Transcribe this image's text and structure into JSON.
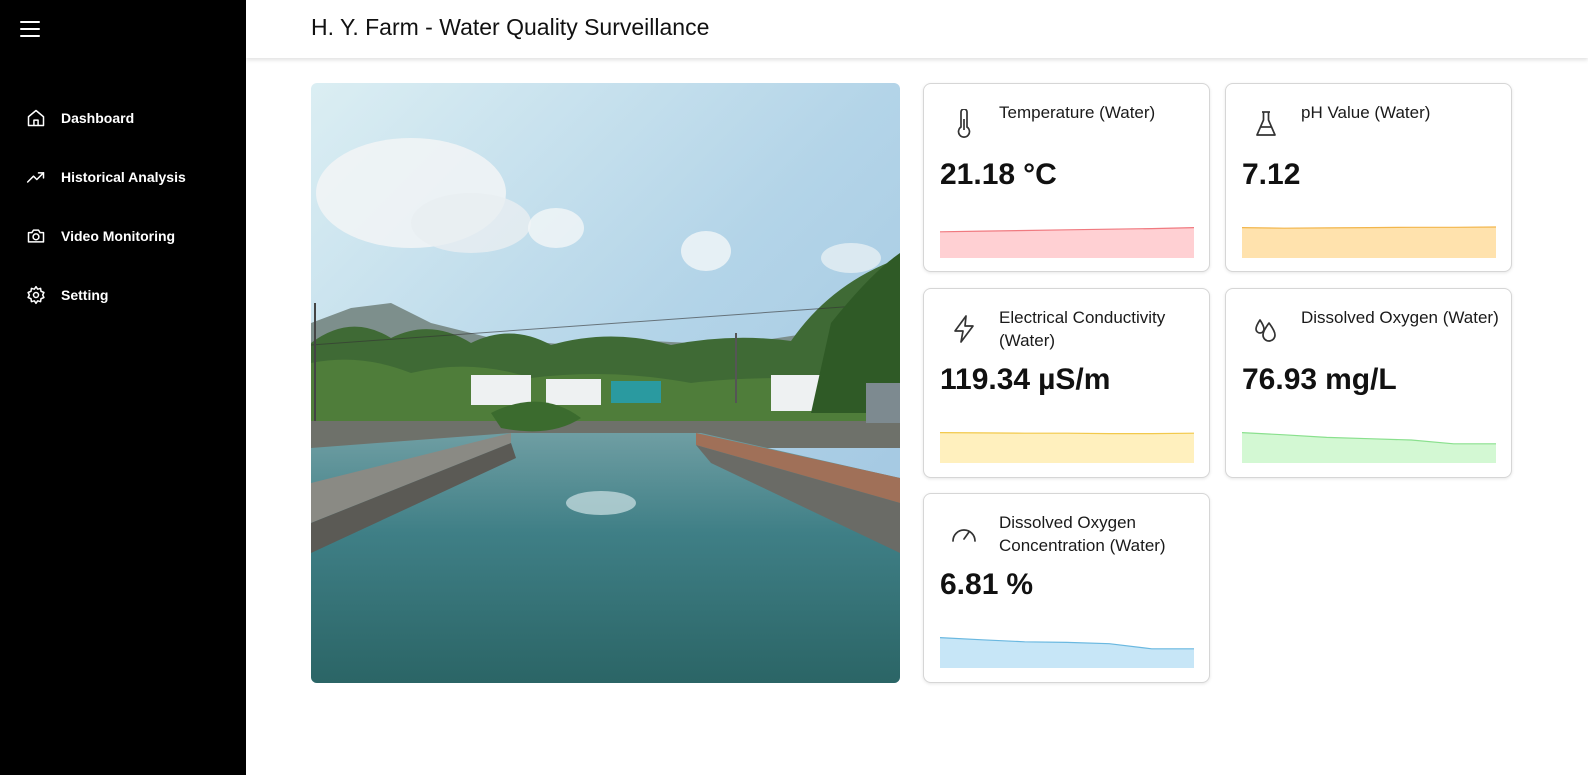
{
  "header": {
    "title": "H. Y. Farm - Water Quality Surveillance"
  },
  "sidebar": {
    "menu_icon": "hamburger-menu-icon",
    "items": [
      {
        "label": "Dashboard",
        "icon": "home-icon"
      },
      {
        "label": "Historical Analysis",
        "icon": "trending-up-icon"
      },
      {
        "label": "Video Monitoring",
        "icon": "camera-icon"
      },
      {
        "label": "Setting",
        "icon": "gear-icon"
      }
    ]
  },
  "photo": {
    "subject": "fish-pond-photo"
  },
  "cards": [
    {
      "title": "Temperature (Water)",
      "value": "21.18",
      "unit": "°C",
      "icon": "thermometer-icon",
      "color": "#f07a80",
      "fill": "#ffd0d3",
      "trend": [
        0.82,
        0.84,
        0.86,
        0.88,
        0.9,
        0.92,
        0.95
      ]
    },
    {
      "title": "pH Value (Water)",
      "value": "7.12",
      "unit": "",
      "icon": "flask-icon",
      "color": "#f2b64c",
      "fill": "#ffe2ad",
      "trend": [
        0.95,
        0.93,
        0.94,
        0.95,
        0.96,
        0.96,
        0.97
      ]
    },
    {
      "title": "Electrical Conductivity (Water)",
      "value": "119.34",
      "unit": "µS/m",
      "icon": "lightning-icon",
      "color": "#f2c94c",
      "fill": "#fff0be",
      "trend": [
        0.95,
        0.94,
        0.93,
        0.93,
        0.92,
        0.92,
        0.93
      ]
    },
    {
      "title": "Dissolved Oxygen (Water)",
      "value": "76.93",
      "unit": "mg/L",
      "icon": "droplets-icon",
      "color": "#8ae08e",
      "fill": "#d3f8d3",
      "trend": [
        0.95,
        0.88,
        0.8,
        0.76,
        0.72,
        0.6,
        0.6
      ]
    },
    {
      "title": "Dissolved Oxygen Concentration (Water)",
      "value": "6.81",
      "unit": "%",
      "icon": "gauge-icon",
      "color": "#6ab8e0",
      "fill": "#c7e6f7",
      "trend": [
        0.95,
        0.88,
        0.82,
        0.8,
        0.76,
        0.6,
        0.6
      ]
    }
  ]
}
